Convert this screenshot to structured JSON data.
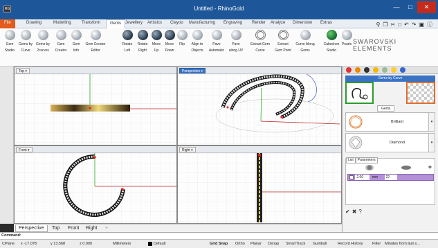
{
  "window": {
    "title": "Untitled - RhinoGold",
    "app_icon": "RG"
  },
  "ribbon_tabs": [
    "File",
    "Drawing",
    "Modelling",
    "Transform",
    "Gems",
    "Jewellery",
    "Artistics",
    "Clayoo",
    "Manufacturing",
    "Engraving",
    "Render",
    "Analyze",
    "Dimension",
    "Extras"
  ],
  "active_tab": "Gems",
  "ribbon_buttons": [
    {
      "label1": "Gem",
      "label2": "Studio"
    },
    {
      "label1": "Gems by",
      "label2": "Curve"
    },
    {
      "label1": "Gems by",
      "label2": "2curves"
    },
    {
      "label1": "Gem",
      "label2": "Creator"
    },
    {
      "label1": "Gem",
      "label2": "Info"
    },
    {
      "label1": "Gem Creator",
      "label2": "Editor"
    },
    {
      "label1": "Rotate",
      "label2": "Left"
    },
    {
      "label1": "Rotate",
      "label2": "Right"
    },
    {
      "label1": "Move",
      "label2": "Up"
    },
    {
      "label1": "Move",
      "label2": "Down"
    },
    {
      "label1": "Flip",
      "label2": ""
    },
    {
      "label1": "Align to",
      "label2": "Objects"
    },
    {
      "label1": "Pave",
      "label2": "Automatic"
    },
    {
      "label1": "Pave",
      "label2": "along UV"
    },
    {
      "label1": "Extract Gem",
      "label2": "Curve"
    },
    {
      "label1": "Extract",
      "label2": "Gem Point"
    },
    {
      "label1": "Curve Along",
      "label2": "Gems"
    },
    {
      "label1": "Cabochon",
      "label2": "Studio"
    },
    {
      "label1": "Pearls",
      "label2": ""
    }
  ],
  "brand": {
    "line1": "SWAROVSKI",
    "line2": "ELEMENTS"
  },
  "viewports": {
    "top": "Top",
    "perspective": "Perspective",
    "front": "Front",
    "right": "Right"
  },
  "viewport_tabs": [
    "Perspective",
    "Top",
    "Front",
    "Right"
  ],
  "right_panel": {
    "header": "Gems by Curve",
    "gems_tab": "Gems",
    "gem1": "Brilliant",
    "gem2": "Diamond",
    "list_tab": "List",
    "params_tab": "Parameters",
    "size_value": "2.00",
    "size_unit": "mm",
    "count_value": "22"
  },
  "command": {
    "label": "Command:"
  },
  "status": {
    "cplane": "CPlane",
    "x": "x -17.078",
    "y": "y 13.568",
    "z": "z 0.000",
    "units": "Millimeters",
    "layer": "Default",
    "grid_snap": "Grid Snap",
    "ortho": "Ortho",
    "planar": "Planar",
    "osnap": "Osnap",
    "smarttrack": "SmartTrack",
    "gumball": "Gumball",
    "record_history": "Record History",
    "filter": "Filter",
    "minutes": "Minutes from last s..."
  },
  "colors": {
    "accent": "#3b73c4",
    "file_tab": "#e35b1d",
    "titlebar": "#1e5799",
    "close": "#c42b1c"
  }
}
